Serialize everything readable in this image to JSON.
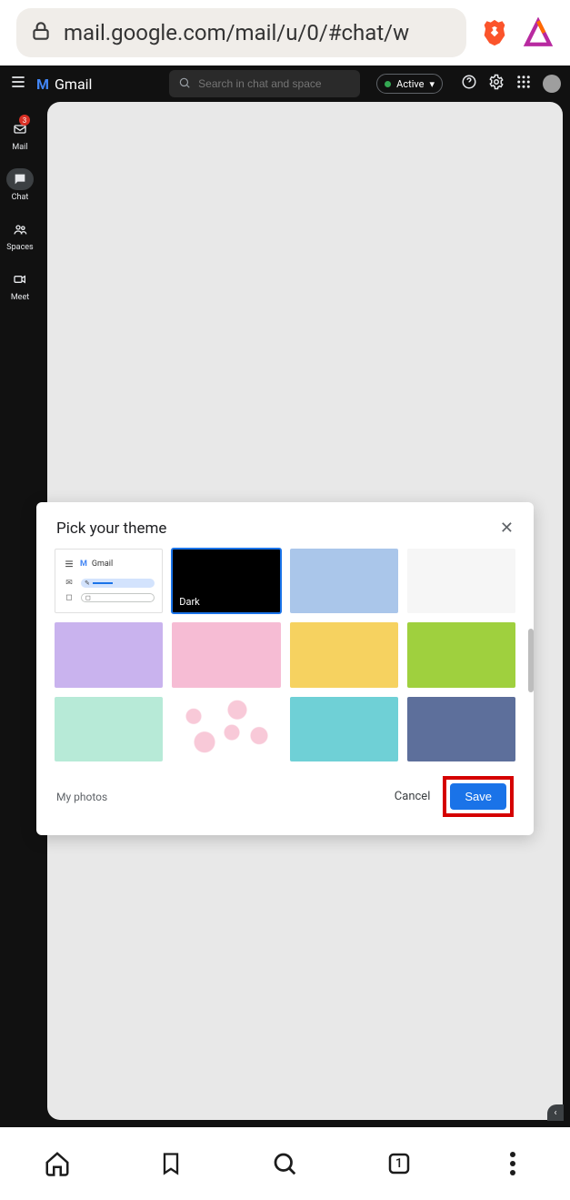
{
  "browser": {
    "url": "mail.google.com/mail/u/0/#chat/w"
  },
  "gmail": {
    "brand": "Gmail",
    "search_placeholder": "Search in chat and space",
    "status": "Active"
  },
  "rail": {
    "mail": {
      "label": "Mail",
      "badge": "3"
    },
    "chat": {
      "label": "Chat"
    },
    "spaces": {
      "label": "Spaces"
    },
    "meet": {
      "label": "Meet"
    }
  },
  "modal": {
    "title": "Pick your theme",
    "default_tile_brand": "Gmail",
    "themes": [
      {
        "id": "default",
        "type": "default"
      },
      {
        "id": "dark",
        "color": "#000000",
        "label": "Dark",
        "selected": true
      },
      {
        "id": "blue",
        "color": "#aac6ea"
      },
      {
        "id": "white",
        "color": "#f6f6f6"
      },
      {
        "id": "lavender",
        "color": "#c9b3ee"
      },
      {
        "id": "rose",
        "color": "#f6bcd4"
      },
      {
        "id": "mustard",
        "color": "#f6d260"
      },
      {
        "id": "wasabi",
        "color": "#9fd03e"
      },
      {
        "id": "mint",
        "color": "#b7ead7"
      },
      {
        "id": "cherry",
        "type": "cherry"
      },
      {
        "id": "cyan",
        "color": "#6fd0d6"
      },
      {
        "id": "slate",
        "color": "#5d6f9b"
      }
    ],
    "my_photos": "My photos",
    "cancel": "Cancel",
    "save": "Save"
  },
  "mobilebar": {
    "tab_count": "1"
  }
}
